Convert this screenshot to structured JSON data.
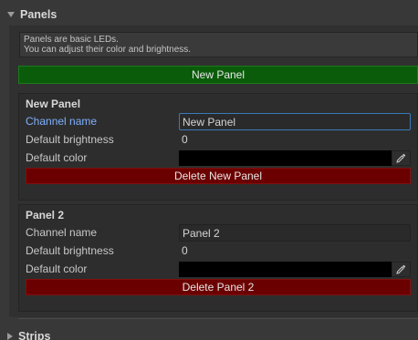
{
  "panels_section": {
    "title": "Panels",
    "help_line_1": "Panels are basic LEDs.",
    "help_line_2": "You can adjust their color and brightness.",
    "new_panel_button": "New Panel"
  },
  "panels": [
    {
      "title": "New Panel",
      "channel_name_label": "Channel name",
      "channel_name_value": "New Panel",
      "brightness_label": "Default brightness",
      "brightness_value": "0",
      "color_label": "Default color",
      "color_value": "#000000",
      "delete_button": "Delete New Panel"
    },
    {
      "title": "Panel 2",
      "channel_name_label": "Channel name",
      "channel_name_value": "Panel 2",
      "brightness_label": "Default brightness",
      "brightness_value": "0",
      "color_label": "Default color",
      "color_value": "#000000",
      "delete_button": "Delete Panel 2"
    }
  ],
  "strips_section": {
    "title": "Strips"
  },
  "colors": {
    "add_button": "#0a5c0a",
    "delete_button": "#6b0000",
    "focus_label": "#7fb0ff",
    "focus_border": "#3a79bb"
  },
  "icons": {
    "foldout_open": "triangle-down-icon",
    "foldout_closed": "triangle-right-icon",
    "color_picker": "eyedropper-icon"
  }
}
